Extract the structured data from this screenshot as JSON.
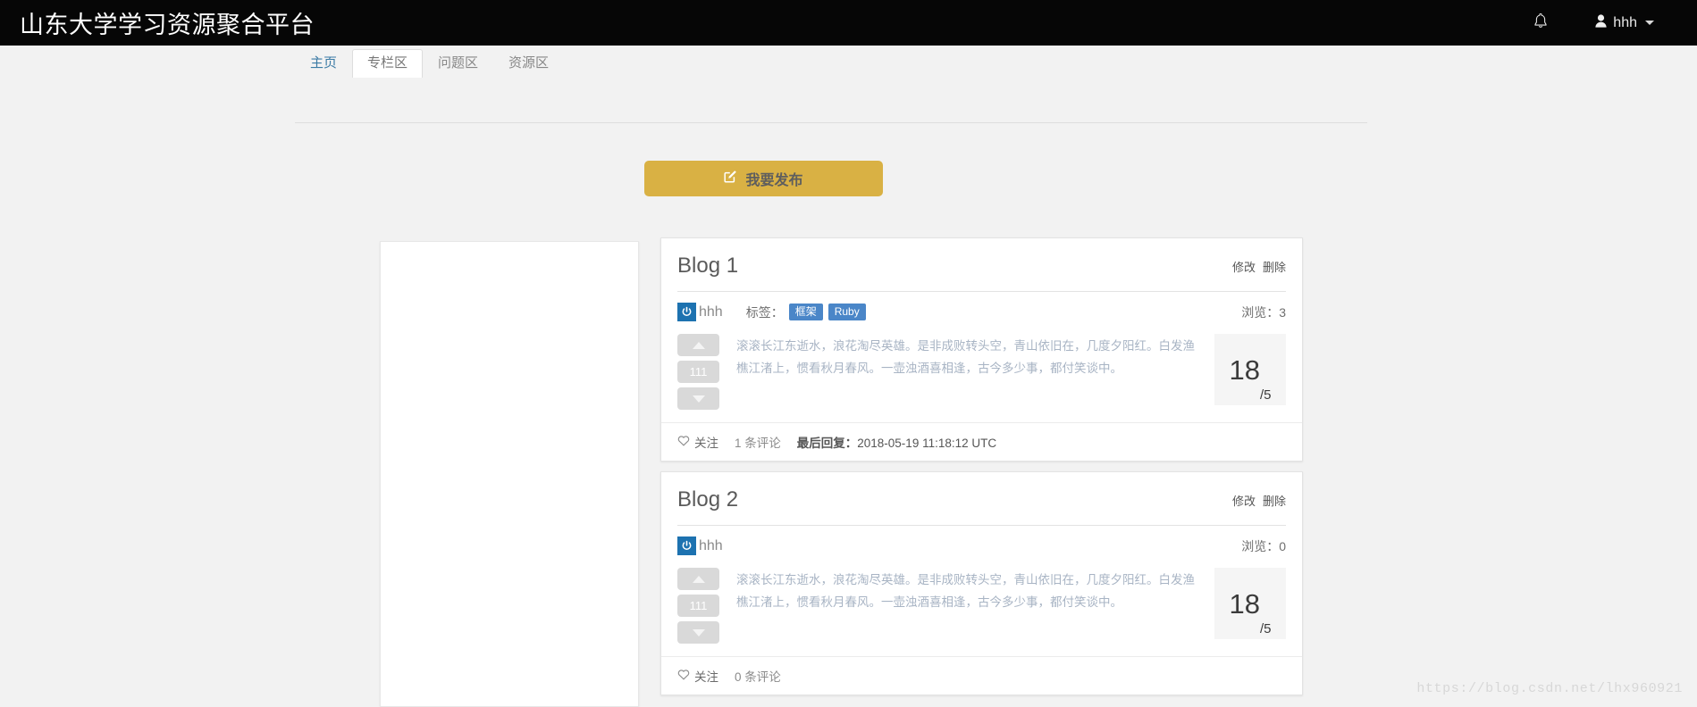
{
  "header": {
    "brand": "山东大学学习资源聚合平台",
    "bell_icon": "bell-icon",
    "user_icon": "user-icon",
    "user_name": "hhh"
  },
  "tabs": [
    {
      "label": "主页",
      "active": false,
      "style": "home"
    },
    {
      "label": "专栏区",
      "active": true,
      "style": "active"
    },
    {
      "label": "问题区",
      "active": false,
      "style": ""
    },
    {
      "label": "资源区",
      "active": false,
      "style": ""
    }
  ],
  "toolbar": {
    "publish_label": "我要发布",
    "publish_icon": "edit-square-icon",
    "publish_color": "#d9b144"
  },
  "sidebar": {
    "empty": true
  },
  "cards": [
    {
      "title": "Blog 1",
      "edit_label": "修改",
      "delete_label": "删除",
      "avatar_icon": "power-icon",
      "author": "hhh",
      "tags_label": "标签：",
      "tags": [
        "框架",
        "Ruby"
      ],
      "views_label": "浏览：3",
      "vote_count": "111",
      "excerpt": "滚滚长江东逝水，浪花淘尽英雄。是非成败转头空，青山依旧在，几度夕阳红。白发渔樵江渚上，惯看秋月春风。一壶浊酒喜相逢，古今多少事，都付笑谈中。",
      "score_main": "18",
      "score_sub": "/5",
      "follow_label": "关注",
      "follow_icon": "heart-icon",
      "comments_label": "1 条评论",
      "last_reply_label": "最后回复：",
      "last_reply_time": "2018-05-19 11:18:12 UTC"
    },
    {
      "title": "Blog 2",
      "edit_label": "修改",
      "delete_label": "删除",
      "avatar_icon": "power-icon",
      "author": "hhh",
      "tags_label": "",
      "tags": [],
      "views_label": "浏览：0",
      "vote_count": "111",
      "excerpt": "滚滚长江东逝水，浪花淘尽英雄。是非成败转头空，青山依旧在，几度夕阳红。白发渔樵江渚上，惯看秋月春风。一壶浊酒喜相逢，古今多少事，都付笑谈中。",
      "score_main": "18",
      "score_sub": "/5",
      "follow_label": "关注",
      "follow_icon": "heart-icon",
      "comments_label": "0 条评论",
      "last_reply_label": "",
      "last_reply_time": ""
    }
  ],
  "watermark": "https://blog.csdn.net/lhx960921",
  "colors": {
    "navbar_bg": "#060606",
    "page_bg": "#f2f2f2",
    "tag_blue": "#4a86c8",
    "avatar_blue": "#1d72b0",
    "accent_gold": "#d9b144"
  }
}
